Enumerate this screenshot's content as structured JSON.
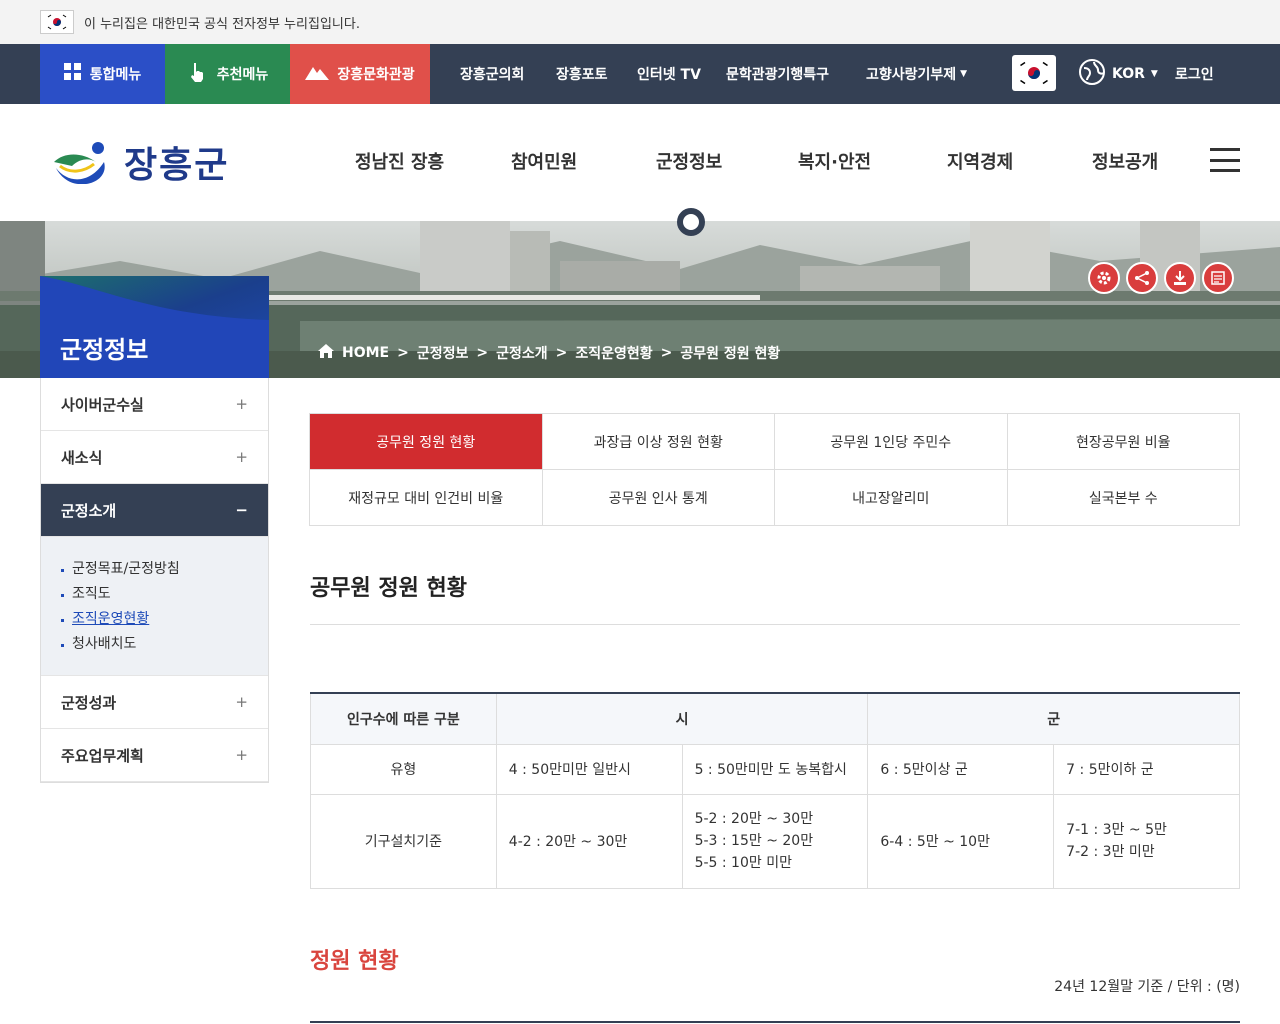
{
  "gov_bar": {
    "text": "이 누리집은 대한민국 공식 전자정부 누리집입니다."
  },
  "top_nav": {
    "integrated_menu": "통합메뉴",
    "recommended_menu": "추천메뉴",
    "culture_tourism": "장흥문화관광",
    "links": [
      "장흥군의회",
      "장흥포토",
      "인터넷 TV",
      "문학관광기행특구",
      "고향사랑기부제"
    ],
    "language": "KOR",
    "login": "로그인",
    "colors": {
      "integrated": "#2b4fc7",
      "recommended": "#2a8a52",
      "culture": "#e0504a",
      "bar": "#344054"
    }
  },
  "header": {
    "logo_text": "장흥군",
    "gnb": [
      "정남진 장흥",
      "참여민원",
      "군정정보",
      "복지·안전",
      "지역경제",
      "정보공개"
    ]
  },
  "visual": {
    "section_title": "군정정보",
    "breadcrumb": [
      "HOME",
      "군정정보",
      "군정소개",
      "조직운영현황",
      "공무원 정원 현황"
    ],
    "quick_icons": [
      "gear-icon",
      "share-icon",
      "download-icon",
      "survey-icon"
    ]
  },
  "lnb": {
    "items": [
      {
        "label": "사이버군수실",
        "toggle": "+"
      },
      {
        "label": "새소식",
        "toggle": "+"
      },
      {
        "label": "군정소개",
        "toggle": "−"
      },
      {
        "label": "군정성과",
        "toggle": "+"
      },
      {
        "label": "주요업무계획",
        "toggle": "+"
      }
    ],
    "sub_items": [
      "군정목표/군정방침",
      "조직도",
      "조직운영현황",
      "청사배치도"
    ]
  },
  "tabs": [
    "공무원 정원 현황",
    "과장급 이상 정원 현황",
    "공무원 1인당 주민수",
    "현장공무원 비율",
    "재정규모 대비 인건비 비율",
    "공무원 인사 통계",
    "내고장알리미",
    "실국본부 수"
  ],
  "page_title": "공무원 정원 현황",
  "table": {
    "head": [
      "인구수에 따른 구분",
      "시",
      "군"
    ],
    "type_label": "유형",
    "types": [
      "4 : 50만미만 일반시",
      "5 : 50만미만 도 농복합시",
      "6 : 5만이상 군",
      "7 : 5만이하 군"
    ],
    "criteria_label": "기구설치기준",
    "criteria": [
      "4-2 : 20만 ~ 30만",
      "5-2 : 20만 ~ 30만",
      "5-3 : 15만 ~ 20만",
      "5-5 : 10만 미만",
      "6-4 : 5만 ~ 10만",
      "7-1 : 3만 ~ 5만",
      "7-2 : 3만 미만"
    ]
  },
  "section": {
    "title": "정원 현황",
    "unit_note": "24년 12월말 기준 / 단위 : (명)"
  }
}
